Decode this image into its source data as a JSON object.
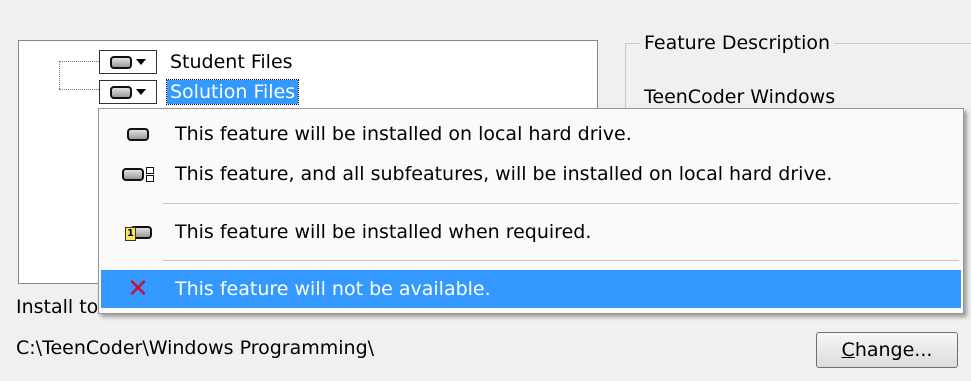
{
  "tree": {
    "items": [
      {
        "label": "Student Files",
        "selected": false
      },
      {
        "label": "Solution Files",
        "selected": true
      }
    ]
  },
  "feature": {
    "title": "Feature Description",
    "text": "TeenCoder Windows"
  },
  "install": {
    "label": "Install to:",
    "path": "C:\\TeenCoder\\Windows Programming\\"
  },
  "buttons": {
    "change_label": "hange..."
  },
  "menu": {
    "items": [
      {
        "label": "This feature will be installed on local hard drive.",
        "icon": "hard-drive-icon"
      },
      {
        "label": "This feature, and all subfeatures, will be installed on local hard drive.",
        "icon": "hard-drive-subfeatures-icon"
      },
      {
        "label": "This feature will be installed when required.",
        "icon": "install-on-demand-icon"
      },
      {
        "label": "This feature will not be available.",
        "icon": "red-x-icon",
        "highlighted": true
      }
    ]
  },
  "colors": {
    "highlight": "#3399ff",
    "x_icon": "#c0143c"
  }
}
